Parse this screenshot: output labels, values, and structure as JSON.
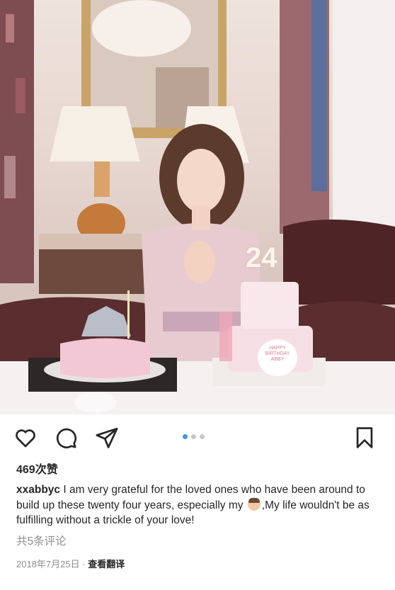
{
  "post": {
    "likes": "469次赞",
    "username": "xxabbyc",
    "caption_part1": " I am very grateful for the loved ones who have been around to build up these twenty four years, especially my ",
    "caption_part2": ",My life wouldn't be as fulfilling without a trickle of your love!",
    "comments_link": "共5条评论",
    "date": "2018年7月25日",
    "separator": " · ",
    "translate": "查看翻译"
  },
  "photo": {
    "cake_topper": "24",
    "cake_text": "HAPPY BIRTHDAY ABBY"
  },
  "carousel": {
    "total": 3,
    "active": 1
  },
  "icons": [
    "heart-icon",
    "comment-icon",
    "share-icon",
    "bookmark-icon"
  ],
  "colors": {
    "accent": "#3897f0",
    "text": "#262626",
    "secondary": "#8e8e8e"
  }
}
